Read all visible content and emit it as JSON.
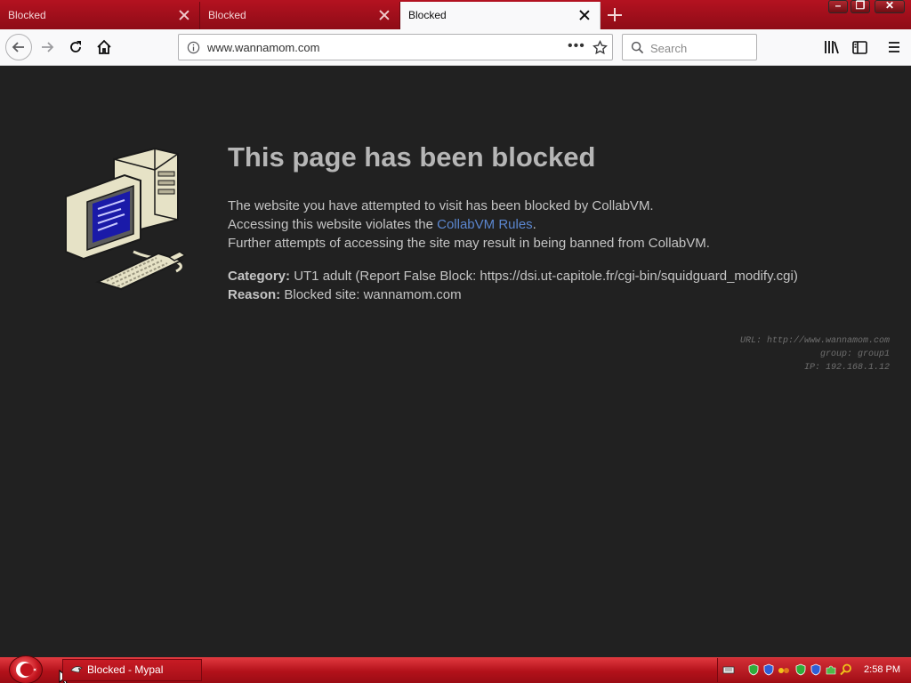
{
  "browser": {
    "tabs": [
      {
        "label": "Blocked",
        "active": false
      },
      {
        "label": "Blocked",
        "active": false
      },
      {
        "label": "Blocked",
        "active": true
      }
    ],
    "url": "www.wannamom.com",
    "search_placeholder": "Search"
  },
  "page": {
    "title": "This page has been blocked",
    "line1": "The website you have attempted to visit has been blocked by CollabVM.",
    "line2_prefix": "Accessing this website violates the ",
    "line2_link": "CollabVM Rules",
    "line2_suffix": ".",
    "line3": "Further attempts of accessing the site may result in being banned from CollabVM.",
    "category_label": "Category:",
    "category_value": "UT1 adult (Report False Block: https://dsi.ut-capitole.fr/cgi-bin/squidguard_modify.cgi)",
    "reason_label": "Reason:",
    "reason_value": "Blocked site: wannamom.com",
    "debug": {
      "url": "URL: http://www.wannamom.com",
      "group": "group: group1",
      "ip": "IP: 192.168.1.12"
    }
  },
  "taskbar": {
    "task_label": "Blocked - Mypal",
    "clock": "2:58 PM"
  },
  "colors": {
    "accent": "#b41220",
    "page_bg": "#212121",
    "link": "#5b86cf"
  }
}
